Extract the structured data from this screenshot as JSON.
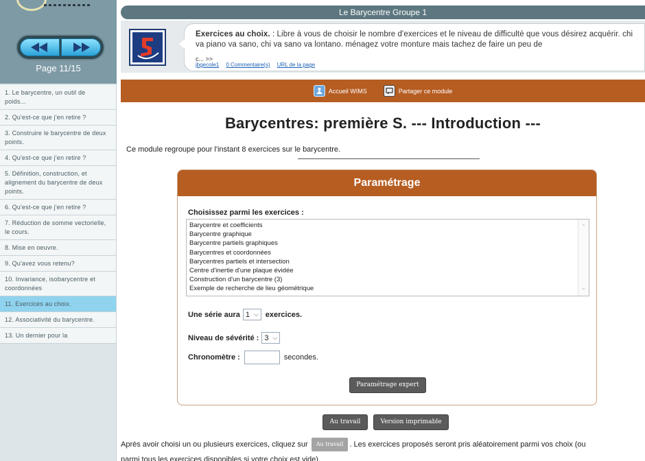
{
  "window": {
    "title": "Le Barycentre Groupe 1"
  },
  "sidebar": {
    "prev_label": "previous-page",
    "next_label": "next-page",
    "page_counter": "Page 11/15",
    "items": [
      {
        "label": "1. Le barycentre, un outil de poids..."
      },
      {
        "label": "2. Qu'est-ce que j'en retire ?"
      },
      {
        "label": "3. Construire le barycentre de deux points."
      },
      {
        "label": "4. Qu'est-ce que j'en retire ?"
      },
      {
        "label": "5. Définition, construction, et alignement du barycentre de deux points."
      },
      {
        "label": "6. Qu'est-ce que j'en retire ?"
      },
      {
        "label": "7. Réduction de somme vectorielle, le cours."
      },
      {
        "label": "8. Mise en oeuvre."
      },
      {
        "label": "9. Qu'avez vous retenu?"
      },
      {
        "label": "10. Invariance, isobarycentre et coordonnées"
      },
      {
        "label": "11. Exercices au choix."
      },
      {
        "label": "12. Associativité du barycentre."
      },
      {
        "label": "13. Un dernier pour la"
      }
    ],
    "active_index": 10
  },
  "intro": {
    "heading": "Exercices au choix.",
    "text": " : Libre à vous de choisir le nombre d'exercices et le niveau de difficulté que vous désirez acquérir. chi va piano va sano, chi va sano va lontano. ménagez votre monture mais tachez de faire un peu de",
    "more": "c... >>",
    "links": [
      "jbgecole1",
      "0 Commentaire(s)",
      "URL de la page"
    ]
  },
  "toolbar": {
    "home_label": "Accueil WIMS",
    "share_label": "Partager ce module"
  },
  "main": {
    "title": "Barycentres: première S. --- Introduction ---",
    "intro_line": "Ce module regroupe pour l'instant 8 exercices sur le barycentre."
  },
  "settings": {
    "heading": "Paramétrage",
    "exercise_label": "Choisissez parmi les exercices :",
    "exercises": [
      "Barycentre et coefficients",
      "Barycentre graphique",
      "Barycentre partiels graphiques",
      "Barycentres et coordonnées",
      "Barycentres partiels et intersection",
      "Centre d'inertie d'une plaque évidée",
      "Construction d'un barycentre (3)",
      "Exemple de recherche de lieu géométrique"
    ],
    "series_label": "Une série aura",
    "series_value": "1",
    "series_after": "exercices.",
    "severity_label": "Niveau de sévérité :",
    "severity_value": "3",
    "chrono_label": "Chronomètre :",
    "chrono_value": "",
    "chrono_after": "secondes.",
    "expert_button": "Paramétrage expert"
  },
  "actions": {
    "work_button": "Au travail",
    "print_button": "Version imprimable",
    "bottom_pre": "Après avoir choisi un ou plusieurs exercices, cliquez sur",
    "bottom_btn": "Au travail",
    "bottom_post": ". Les exercices proposés seront pris aléatoirement parmi vos choix (ou",
    "bottom_line2": "parmi tous les exercices disponibles si votre choix est vide)."
  },
  "colors": {
    "accent_brown": "#b65d22",
    "nav_blue": "#2aa2d8",
    "active_item": "#8fd3ee",
    "sidebar_header": "#7e9aa5"
  }
}
